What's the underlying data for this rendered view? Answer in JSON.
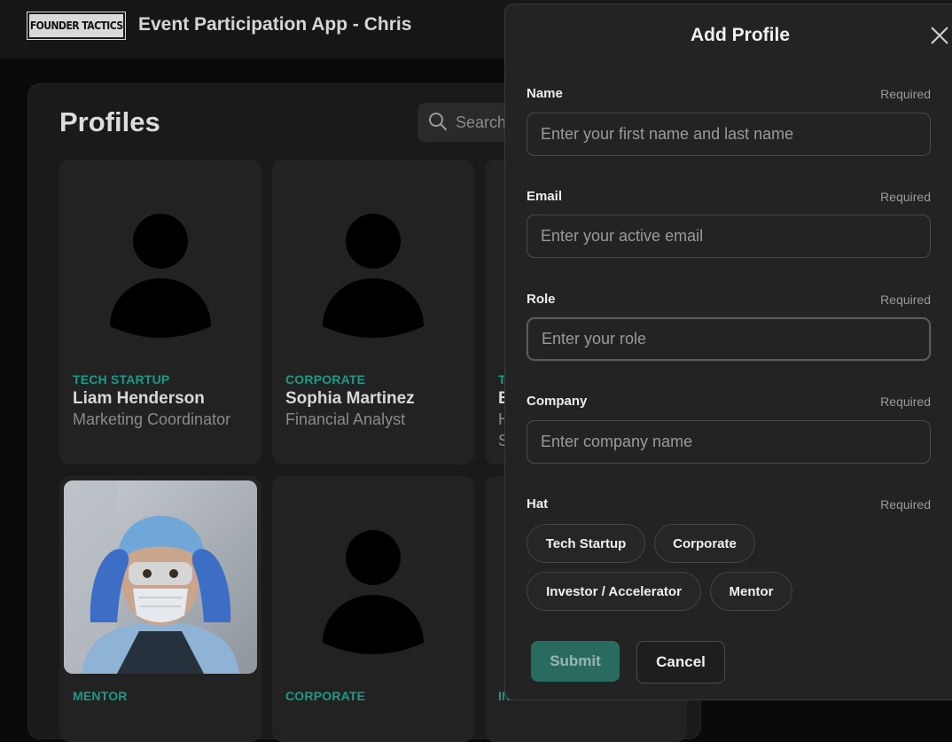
{
  "header": {
    "logo_text": "FOUNDER TACTICS",
    "app_title": "Event Participation App - Chris"
  },
  "profiles": {
    "title": "Profiles",
    "search_placeholder": "Search",
    "cards": [
      {
        "hat": "TECH STARTUP",
        "name": "Liam Henderson",
        "role": "Marketing Coordinator",
        "image": "avatar-placeholder"
      },
      {
        "hat": "CORPORATE",
        "name": "Sophia Martinez",
        "role": "Financial Analyst",
        "image": "avatar-placeholder"
      },
      {
        "hat": "T",
        "name": "E",
        "role": "H",
        "role2": "S",
        "image": "avatar-placeholder"
      },
      {
        "hat": "MENTOR",
        "image": "photo-medical-worker"
      },
      {
        "hat": "CORPORATE",
        "image": "avatar-placeholder"
      },
      {
        "hat": "IN",
        "image": "avatar-placeholder"
      }
    ]
  },
  "dialog": {
    "title": "Add Profile",
    "close_icon": "close-icon",
    "required_label": "Required",
    "fields": {
      "name": {
        "label": "Name",
        "placeholder": "Enter your first name and last name"
      },
      "email": {
        "label": "Email",
        "placeholder": "Enter your active email"
      },
      "role": {
        "label": "Role",
        "placeholder": "Enter your role"
      },
      "company": {
        "label": "Company",
        "placeholder": "Enter company name"
      }
    },
    "hat": {
      "label": "Hat",
      "options": [
        "Tech Startup",
        "Corporate",
        "Investor / Accelerator",
        "Mentor"
      ]
    },
    "submit_label": "Submit",
    "cancel_label": "Cancel"
  },
  "colors": {
    "accent_teal": "#1d9a86",
    "submit_bg": "#2a6b60",
    "background": "#0a0a0a",
    "panel": "#1a1a1a",
    "card": "#222222",
    "drawer": "#232323"
  }
}
